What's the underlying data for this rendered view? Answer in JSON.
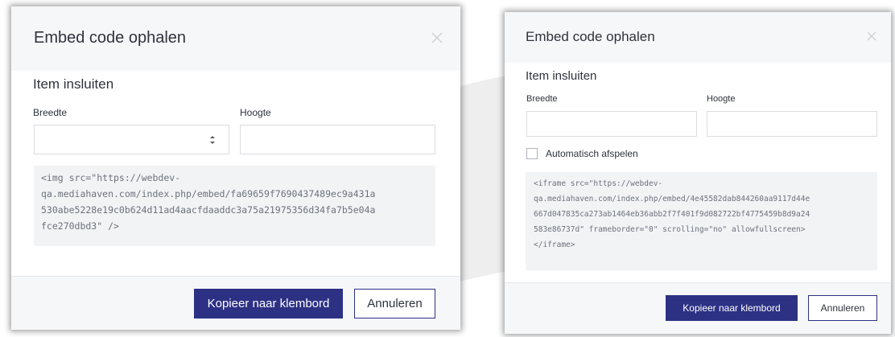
{
  "colors": {
    "primary": "#2c3184",
    "header_bg": "#f6f7f9",
    "code_bg": "#f1f3f5",
    "border": "#d9dce1"
  },
  "left_dialog": {
    "title": "Embed code ophalen",
    "close_icon": "close-icon",
    "section_title": "Item insluiten",
    "width_label": "Breedte",
    "height_label": "Hoogte",
    "width_value": "",
    "height_value": "",
    "code": "<img src=\"https://webdev-\nqa.mediahaven.com/index.php/embed/fa69659f7690437489ec9a431a\n530abe5228e19c0b624d11ad4aacfdaaddc3a75a21975356d34fa7b5e04a\nfce270dbd3\" />",
    "copy_button": "Kopieer naar klembord",
    "cancel_button": "Annuleren"
  },
  "right_dialog": {
    "title": "Embed code ophalen",
    "close_icon": "close-icon",
    "section_title": "Item insluiten",
    "width_label": "Breedte",
    "height_label": "Hoogte",
    "width_value": "",
    "height_value": "",
    "autoplay_label": "Automatisch afspelen",
    "autoplay_checked": false,
    "code": "<iframe src=\"https://webdev-\nqa.mediahaven.com/index.php/embed/4e45582dab844260aa9117d44e\n667d047835ca273ab1464eb36abb2f7f401f9d082722bf4775459b8d9a24\n583e86737d\" frameborder=\"0\" scrolling=\"no\" allowfullscreen>\n</iframe>",
    "copy_button": "Kopieer naar klembord",
    "cancel_button": "Annuleren"
  }
}
